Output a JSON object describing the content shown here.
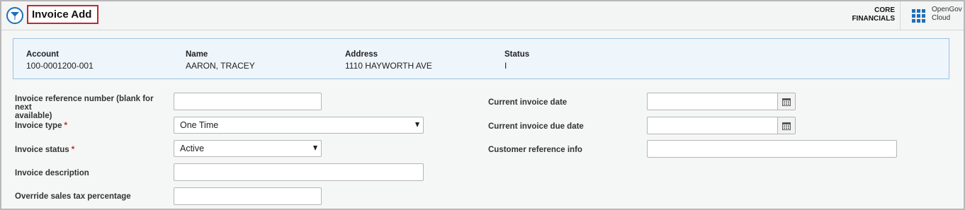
{
  "header": {
    "title": "Invoice Add",
    "product_line1": "CORE",
    "product_line2": "FINANCIALS",
    "brand_line1": "OpenGov",
    "brand_line2": "Cloud"
  },
  "summary": {
    "account": {
      "label": "Account",
      "value": "100-0001200-001"
    },
    "name": {
      "label": "Name",
      "value": "AARON, TRACEY"
    },
    "address": {
      "label": "Address",
      "value": "1110 HAYWORTH AVE"
    },
    "status": {
      "label": "Status",
      "value": "I"
    }
  },
  "form": {
    "invoice_ref": {
      "label_line1": "Invoice reference number (blank for next",
      "label_line2": "available)",
      "value": ""
    },
    "invoice_type": {
      "label": "Invoice type",
      "required_mark": "*",
      "value": "One Time"
    },
    "invoice_status": {
      "label": "Invoice status",
      "required_mark": "*",
      "value": "Active"
    },
    "invoice_description": {
      "label": "Invoice description",
      "value": ""
    },
    "override_tax": {
      "label": "Override sales tax percentage",
      "value": ""
    },
    "current_invoice_date": {
      "label": "Current invoice date",
      "value": ""
    },
    "current_invoice_due_date": {
      "label": "Current invoice due date",
      "value": ""
    },
    "customer_reference_info": {
      "label": "Customer reference info",
      "value": ""
    }
  },
  "icons": {
    "menu": "circle-arrow-down-icon",
    "apps": "grid-apps-icon",
    "calendar": "calendar-icon"
  },
  "colors": {
    "accent": "#1d6fb8",
    "title_outline": "#c0282e",
    "summary_bg": "#eef5fb",
    "summary_border": "#9cc3e2"
  }
}
